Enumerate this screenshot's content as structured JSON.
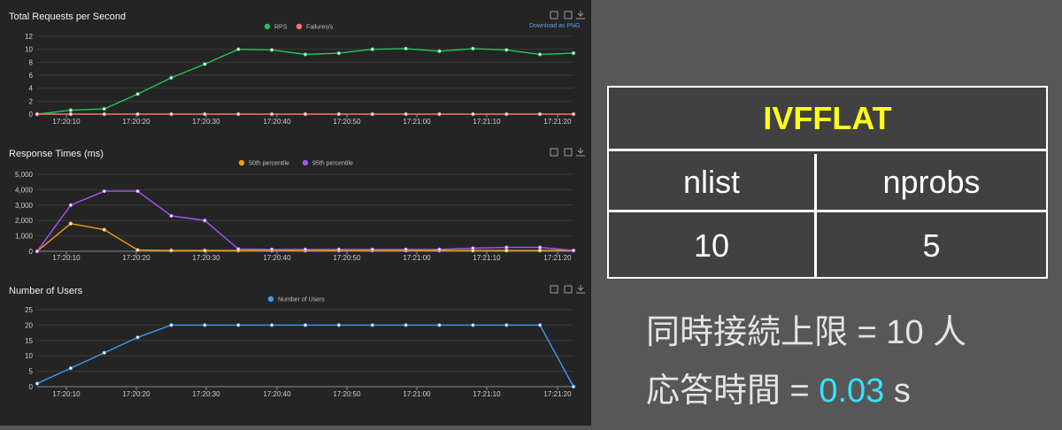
{
  "charts": [
    {
      "type": "line",
      "title": "Total Requests per Second",
      "download_label": "Download as PNG",
      "y_ticks": [
        "0",
        "2",
        "4",
        "6",
        "8",
        "10",
        "12"
      ],
      "ylim": [
        0,
        12
      ],
      "x_ticks": [
        "17:20:10",
        "17:20:20",
        "17:20:30",
        "17:20:40",
        "17:20:50",
        "17:21:00",
        "17:21:10",
        "17:21:20"
      ],
      "legend_position": "top-center",
      "series": [
        {
          "name": "RPS",
          "color": "#22c55e",
          "values": [
            0,
            0.6,
            0.8,
            3.1,
            5.6,
            7.7,
            10,
            9.9,
            9.2,
            9.4,
            10,
            10.1,
            9.7,
            10.1,
            9.9,
            9.2,
            9.4
          ]
        },
        {
          "name": "Failures/s",
          "color": "#f87171",
          "values": [
            0,
            0,
            0,
            0,
            0,
            0,
            0,
            0,
            0,
            0,
            0,
            0,
            0,
            0,
            0,
            0,
            0
          ]
        }
      ]
    },
    {
      "type": "line",
      "title": "Response Times (ms)",
      "y_ticks": [
        "0",
        "1,000",
        "2,000",
        "3,000",
        "4,000",
        "5,000"
      ],
      "ylim": [
        0,
        5000
      ],
      "x_ticks": [
        "17:20:10",
        "17:20:20",
        "17:20:30",
        "17:20:40",
        "17:20:50",
        "17:21:00",
        "17:21:10",
        "17:21:20"
      ],
      "legend_position": "top-center",
      "series": [
        {
          "name": "50th percentile",
          "color": "#f59e0b",
          "values": [
            0,
            1800,
            1400,
            80,
            50,
            50,
            50,
            50,
            50,
            50,
            50,
            50,
            50,
            50,
            50,
            50,
            50
          ]
        },
        {
          "name": "95th percentile",
          "color": "#a855f7",
          "values": [
            0,
            3000,
            3900,
            3900,
            2300,
            2000,
            150,
            120,
            120,
            120,
            120,
            120,
            120,
            200,
            250,
            250,
            50
          ]
        }
      ]
    },
    {
      "type": "line",
      "title": "Number of Users",
      "y_ticks": [
        "0",
        "5",
        "10",
        "15",
        "20",
        "25"
      ],
      "ylim": [
        0,
        25
      ],
      "x_ticks": [
        "17:20:10",
        "17:20:20",
        "17:20:30",
        "17:20:40",
        "17:20:50",
        "17:21:00",
        "17:21:10",
        "17:21:20"
      ],
      "legend_position": "top-center",
      "series": [
        {
          "name": "Number of Users",
          "color": "#3b9cf5",
          "values": [
            1,
            6,
            11,
            16,
            20,
            20,
            20,
            20,
            20,
            20,
            20,
            20,
            20,
            20,
            20,
            20,
            0
          ]
        }
      ]
    }
  ],
  "table": {
    "header": "IVFFLAT",
    "col1_header": "nlist",
    "col2_header": "nprobs",
    "col1_value": "10",
    "col2_value": "5"
  },
  "notes": {
    "line1": "同時接続上限 = 10 人",
    "line2_prefix": "応答時間 = ",
    "line2_value": "0.03",
    "line2_suffix": " s"
  },
  "colors": {
    "page_bg": "#575757",
    "dashboard_bg": "#242424",
    "header_text": "#ffff1a",
    "highlight": "#2fe5ff"
  }
}
